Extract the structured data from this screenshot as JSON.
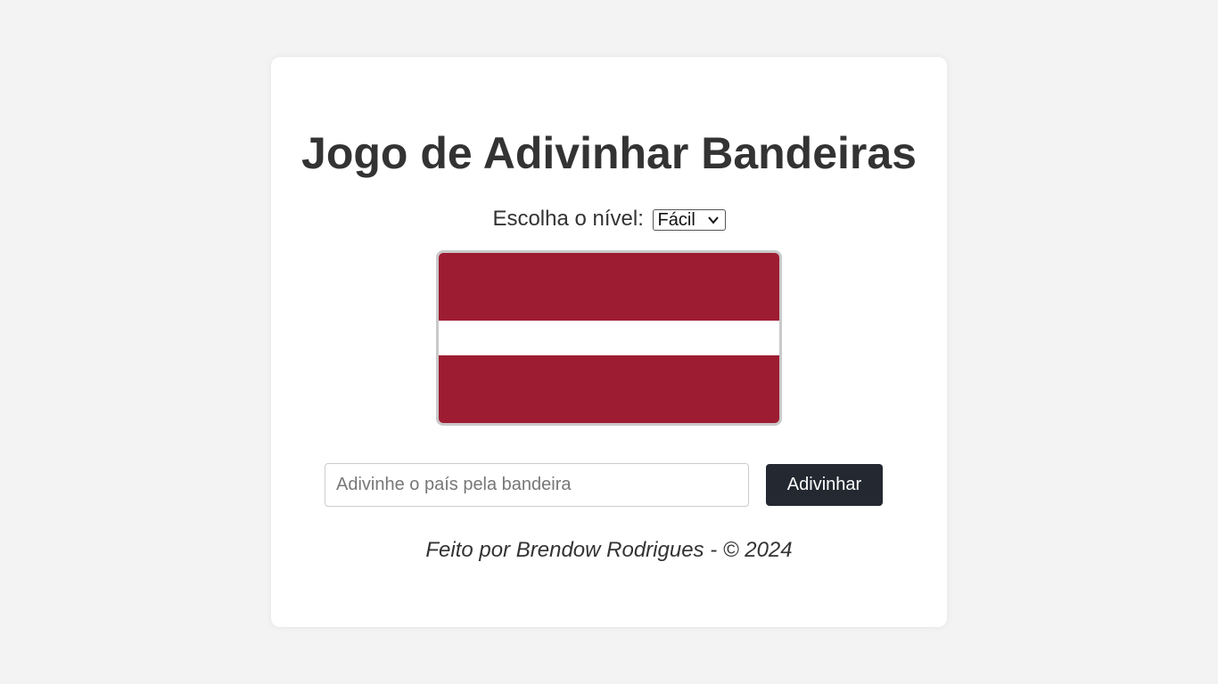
{
  "page": {
    "title": "Jogo de Adivinhar Bandeiras"
  },
  "level": {
    "label": "Escolha o nível:",
    "selected": "Fácil"
  },
  "flag": {
    "name": "flag-image",
    "colors": {
      "stripe_outer": "#9e1c32",
      "stripe_middle": "#ffffff"
    }
  },
  "guess": {
    "placeholder": "Adivinhe o país pela bandeira",
    "value": "",
    "button_label": "Adivinhar"
  },
  "footer": {
    "text": "Feito por Brendow Rodrigues - © 2024"
  },
  "colors": {
    "background": "#f3f3f3",
    "card": "#ffffff",
    "text": "#333333",
    "button": "#232831"
  }
}
